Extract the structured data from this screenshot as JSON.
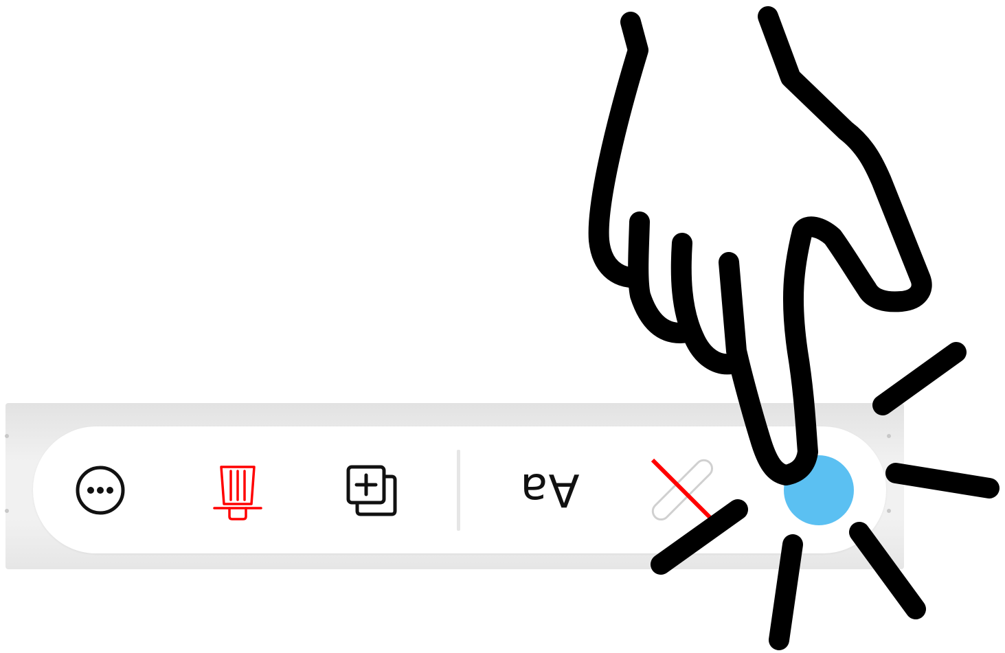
{
  "toolbar": {
    "tools": [
      {
        "name": "more-options",
        "icon": "ellipsis-circle-icon"
      },
      {
        "name": "highlighter",
        "icon": "highlighter-icon",
        "color": "#ff0000"
      },
      {
        "name": "add-page",
        "icon": "add-copy-icon"
      },
      {
        "name": "text-style",
        "icon": "text-style-icon",
        "label": "Aa"
      },
      {
        "name": "no-color",
        "icon": "no-color-icon",
        "color": "#ff0000"
      },
      {
        "name": "color-picker",
        "icon": "color-swatch-icon",
        "color": "#5bc0f2"
      }
    ]
  },
  "overlay": {
    "icon": "tap-gesture-hand-icon"
  }
}
